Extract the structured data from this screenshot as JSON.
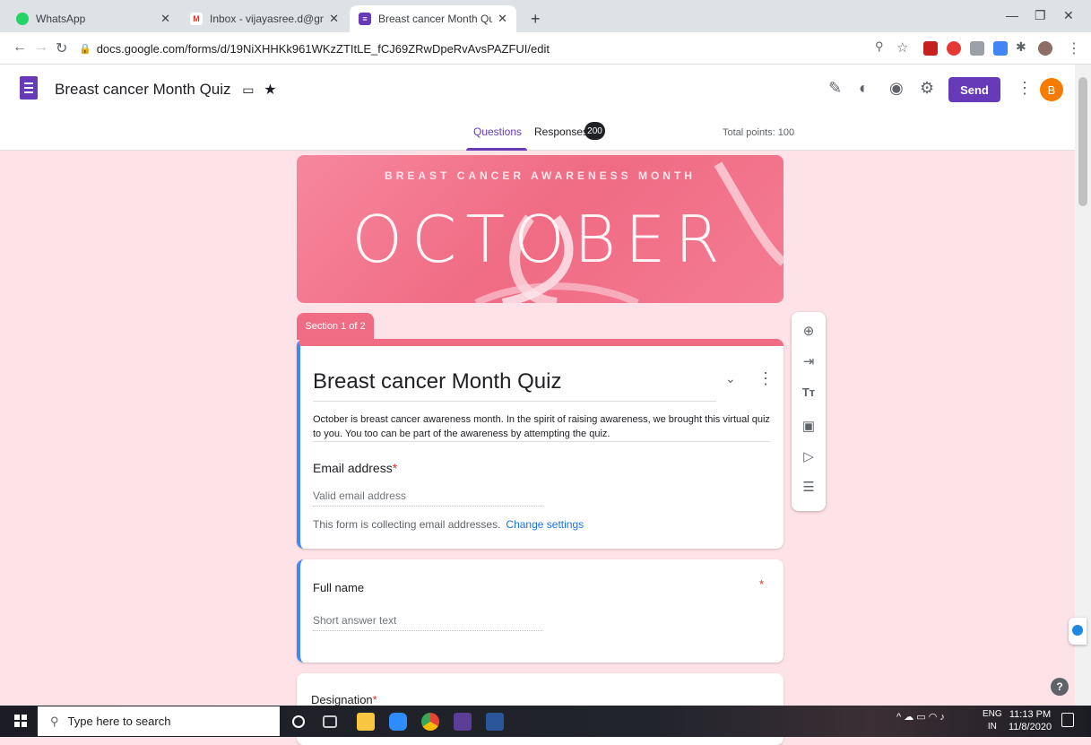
{
  "browser": {
    "tabs": [
      {
        "title": "WhatsApp",
        "icon": "whatsapp-icon"
      },
      {
        "title": "Inbox - vijayasree.d@gmail.com",
        "icon": "gmail-icon"
      },
      {
        "title": "Breast cancer Month Quiz - Goo",
        "icon": "google-forms-icon"
      }
    ],
    "new_tab": "+",
    "url": "docs.google.com/forms/d/19NiXHHKk961WKzZTItLE_fCJ69ZRwDpeRvAvsPAZFUI/edit"
  },
  "form_header": {
    "title": "Breast cancer Month Quiz",
    "send_label": "Send",
    "avatar_letter": "B",
    "tabs": {
      "questions": "Questions",
      "responses": "Responses"
    },
    "responses_count": "200",
    "total_points": "Total points: 100"
  },
  "banner": {
    "top_text": "BREAST CANCER AWARENESS MONTH",
    "main_text": "OCTOBER"
  },
  "section": {
    "tab_label": "Section 1 of 2",
    "title": "Breast cancer Month Quiz",
    "description": "October is breast cancer awareness month. In the spirit of raising awareness, we brought this virtual quiz to you. You too can be part of the awareness by attempting the quiz."
  },
  "questions": [
    {
      "label": "Email address",
      "required": "*",
      "placeholder": "Valid email address",
      "note": "This form is collecting email addresses.",
      "note_link": "Change settings"
    },
    {
      "label": "Full name",
      "required": "*",
      "placeholder": "Short answer text"
    },
    {
      "label": "Designation",
      "required": "*"
    }
  ],
  "taskbar": {
    "search_placeholder": "Type here to search",
    "lang": "ENG",
    "region": "IN",
    "time": "11:13 PM",
    "date": "11/8/2020"
  },
  "colors": {
    "accent": "#673ab7",
    "section_pink": "#f06b84",
    "page_background": "#fde2e7",
    "focus_blue": "#4285f4"
  }
}
